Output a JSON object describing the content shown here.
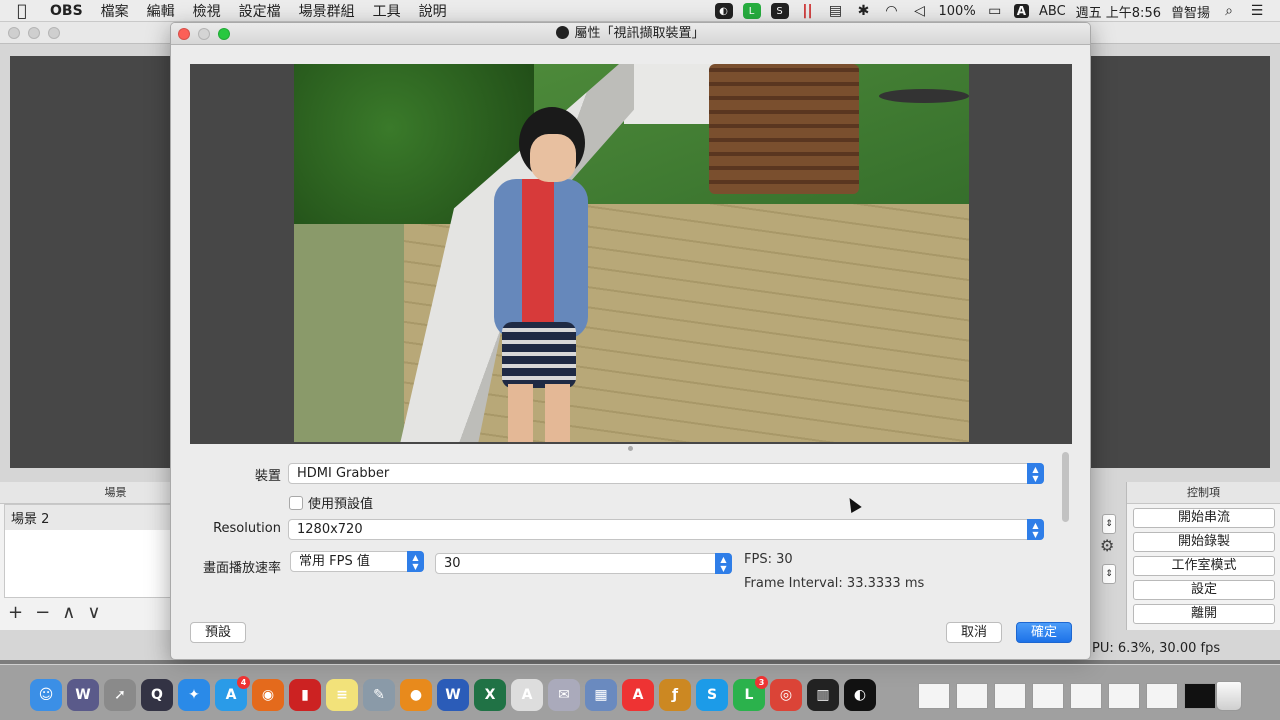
{
  "menubar": {
    "app": "OBS",
    "items": [
      "檔案",
      "編輯",
      "檢視",
      "設定檔",
      "場景群組",
      "工具",
      "說明"
    ],
    "battery": "100%",
    "input_source": "ABC",
    "clock": "週五 上午8:56",
    "user": "曾智揚"
  },
  "main": {
    "scenes_header": "場景",
    "scene_item": "場景 2",
    "scene_tools": [
      "+",
      "−",
      "∧",
      "∨"
    ],
    "controls_header": "控制項",
    "controls": [
      "開始串流",
      "開始錄製",
      "工作室模式",
      "設定",
      "離開"
    ],
    "status": "PU: 6.3%, 30.00 fps"
  },
  "dialog": {
    "title": "屬性「視訊擷取裝置」",
    "device_label": "裝置",
    "device_value": "HDMI Grabber",
    "use_preset_label": "使用預設值",
    "use_preset_checked": false,
    "resolution_label": "Resolution",
    "resolution_value": "1280x720",
    "fps_label": "畫面播放速率",
    "fps_mode_value": "常用 FPS 值",
    "fps_value": "30",
    "fps_info": "FPS: 30",
    "frame_interval": "Frame Interval: 33.3333 ms",
    "defaults_button": "預設",
    "cancel_button": "取消",
    "ok_button": "確定"
  },
  "dock": {
    "icons": [
      {
        "name": "finder-icon",
        "color": "#3b8fe6",
        "glyph": "☺"
      },
      {
        "name": "wiznote-icon",
        "color": "#5a5a8a",
        "glyph": "W"
      },
      {
        "name": "launchpad-icon",
        "color": "#8a8a8a",
        "glyph": "➚"
      },
      {
        "name": "quicktime-icon",
        "color": "#334",
        "glyph": "Q"
      },
      {
        "name": "safari-icon",
        "color": "#2a8ae8",
        "glyph": "✦"
      },
      {
        "name": "app-store-icon",
        "color": "#2a9be8",
        "glyph": "A",
        "badge": "4"
      },
      {
        "name": "firefox-icon",
        "color": "#e46a1c",
        "glyph": "◉"
      },
      {
        "name": "photo-booth-icon",
        "color": "#c22",
        "glyph": "▮"
      },
      {
        "name": "notes-icon",
        "color": "#f2e27a",
        "glyph": "≡"
      },
      {
        "name": "preview-icon",
        "color": "#8a9aa8",
        "glyph": "✎"
      },
      {
        "name": "dvd-icon",
        "color": "#e88a1c",
        "glyph": "●"
      },
      {
        "name": "word-icon",
        "color": "#2b5cb8",
        "glyph": "W"
      },
      {
        "name": "excel-icon",
        "color": "#207245",
        "glyph": "X"
      },
      {
        "name": "textedit-icon",
        "color": "#ddd",
        "glyph": "A"
      },
      {
        "name": "email-icon",
        "color": "#aab",
        "glyph": "✉"
      },
      {
        "name": "system-icon",
        "color": "#6a8abf",
        "glyph": "▦"
      },
      {
        "name": "acrobat-icon",
        "color": "#e33",
        "glyph": "A"
      },
      {
        "name": "flash-icon",
        "color": "#c82",
        "glyph": "ƒ"
      },
      {
        "name": "skype-icon",
        "color": "#1c9be8",
        "glyph": "S"
      },
      {
        "name": "line-icon",
        "color": "#2bb24c",
        "glyph": "L",
        "badge": "3"
      },
      {
        "name": "chrome-icon",
        "color": "#db4437",
        "glyph": "◎"
      },
      {
        "name": "piano-icon",
        "color": "#222",
        "glyph": "▥"
      },
      {
        "name": "obs-icon",
        "color": "#111",
        "glyph": "◐"
      }
    ]
  },
  "colors": {
    "accent": "#1d72e8",
    "close": "#fc5f57",
    "zoom": "#28c840"
  }
}
